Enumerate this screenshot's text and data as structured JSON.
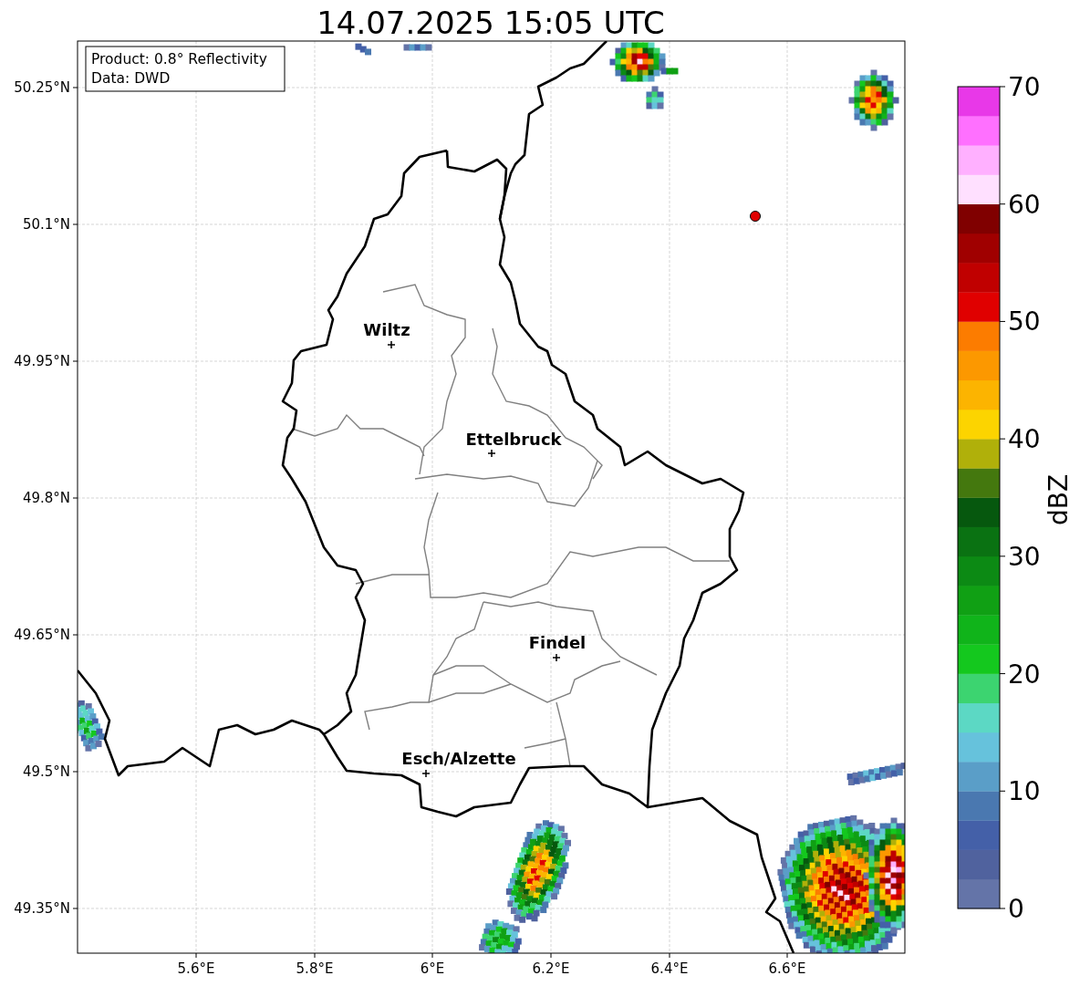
{
  "title": "14.07.2025 15:05 UTC",
  "info_box": [
    "Product: 0.8° Reflectivity",
    "Data: DWD"
  ],
  "map": {
    "x_tick_labels": [
      "5.6°E",
      "5.8°E",
      "6°E",
      "6.2°E",
      "6.4°E",
      "6.6°E"
    ],
    "y_tick_labels": [
      "50.25°N",
      "50.1°N",
      "49.95°N",
      "49.8°N",
      "49.65°N",
      "49.5°N",
      "49.35°N"
    ],
    "places": [
      {
        "name": "Wiltz"
      },
      {
        "name": "Ettelbruck"
      },
      {
        "name": "Findel"
      },
      {
        "name": "Esch/Alzette"
      }
    ]
  },
  "colorbar": {
    "label": "dBZ",
    "tick_labels": [
      "70",
      "60",
      "50",
      "40",
      "30",
      "20",
      "10",
      "0"
    ],
    "bands": [
      {
        "color": "#6474a8"
      },
      {
        "color": "#50629e"
      },
      {
        "color": "#4460a8"
      },
      {
        "color": "#4a78b0"
      },
      {
        "color": "#5a9ec8"
      },
      {
        "color": "#66c2dc"
      },
      {
        "color": "#5cd8c4"
      },
      {
        "color": "#3cd470"
      },
      {
        "color": "#14c81e"
      },
      {
        "color": "#10b41a"
      },
      {
        "color": "#10a014"
      },
      {
        "color": "#0c8a14"
      },
      {
        "color": "#0a7212"
      },
      {
        "color": "#06580e"
      },
      {
        "color": "#44780e"
      },
      {
        "color": "#b0b00a"
      },
      {
        "color": "#fcd400"
      },
      {
        "color": "#fcb400"
      },
      {
        "color": "#fc9800"
      },
      {
        "color": "#fc7c00"
      },
      {
        "color": "#e00000"
      },
      {
        "color": "#c00000"
      },
      {
        "color": "#a00000"
      },
      {
        "color": "#800000"
      },
      {
        "color": "#ffe0ff"
      },
      {
        "color": "#ffb0ff"
      },
      {
        "color": "#ff70ff"
      },
      {
        "color": "#e838e8"
      }
    ]
  }
}
